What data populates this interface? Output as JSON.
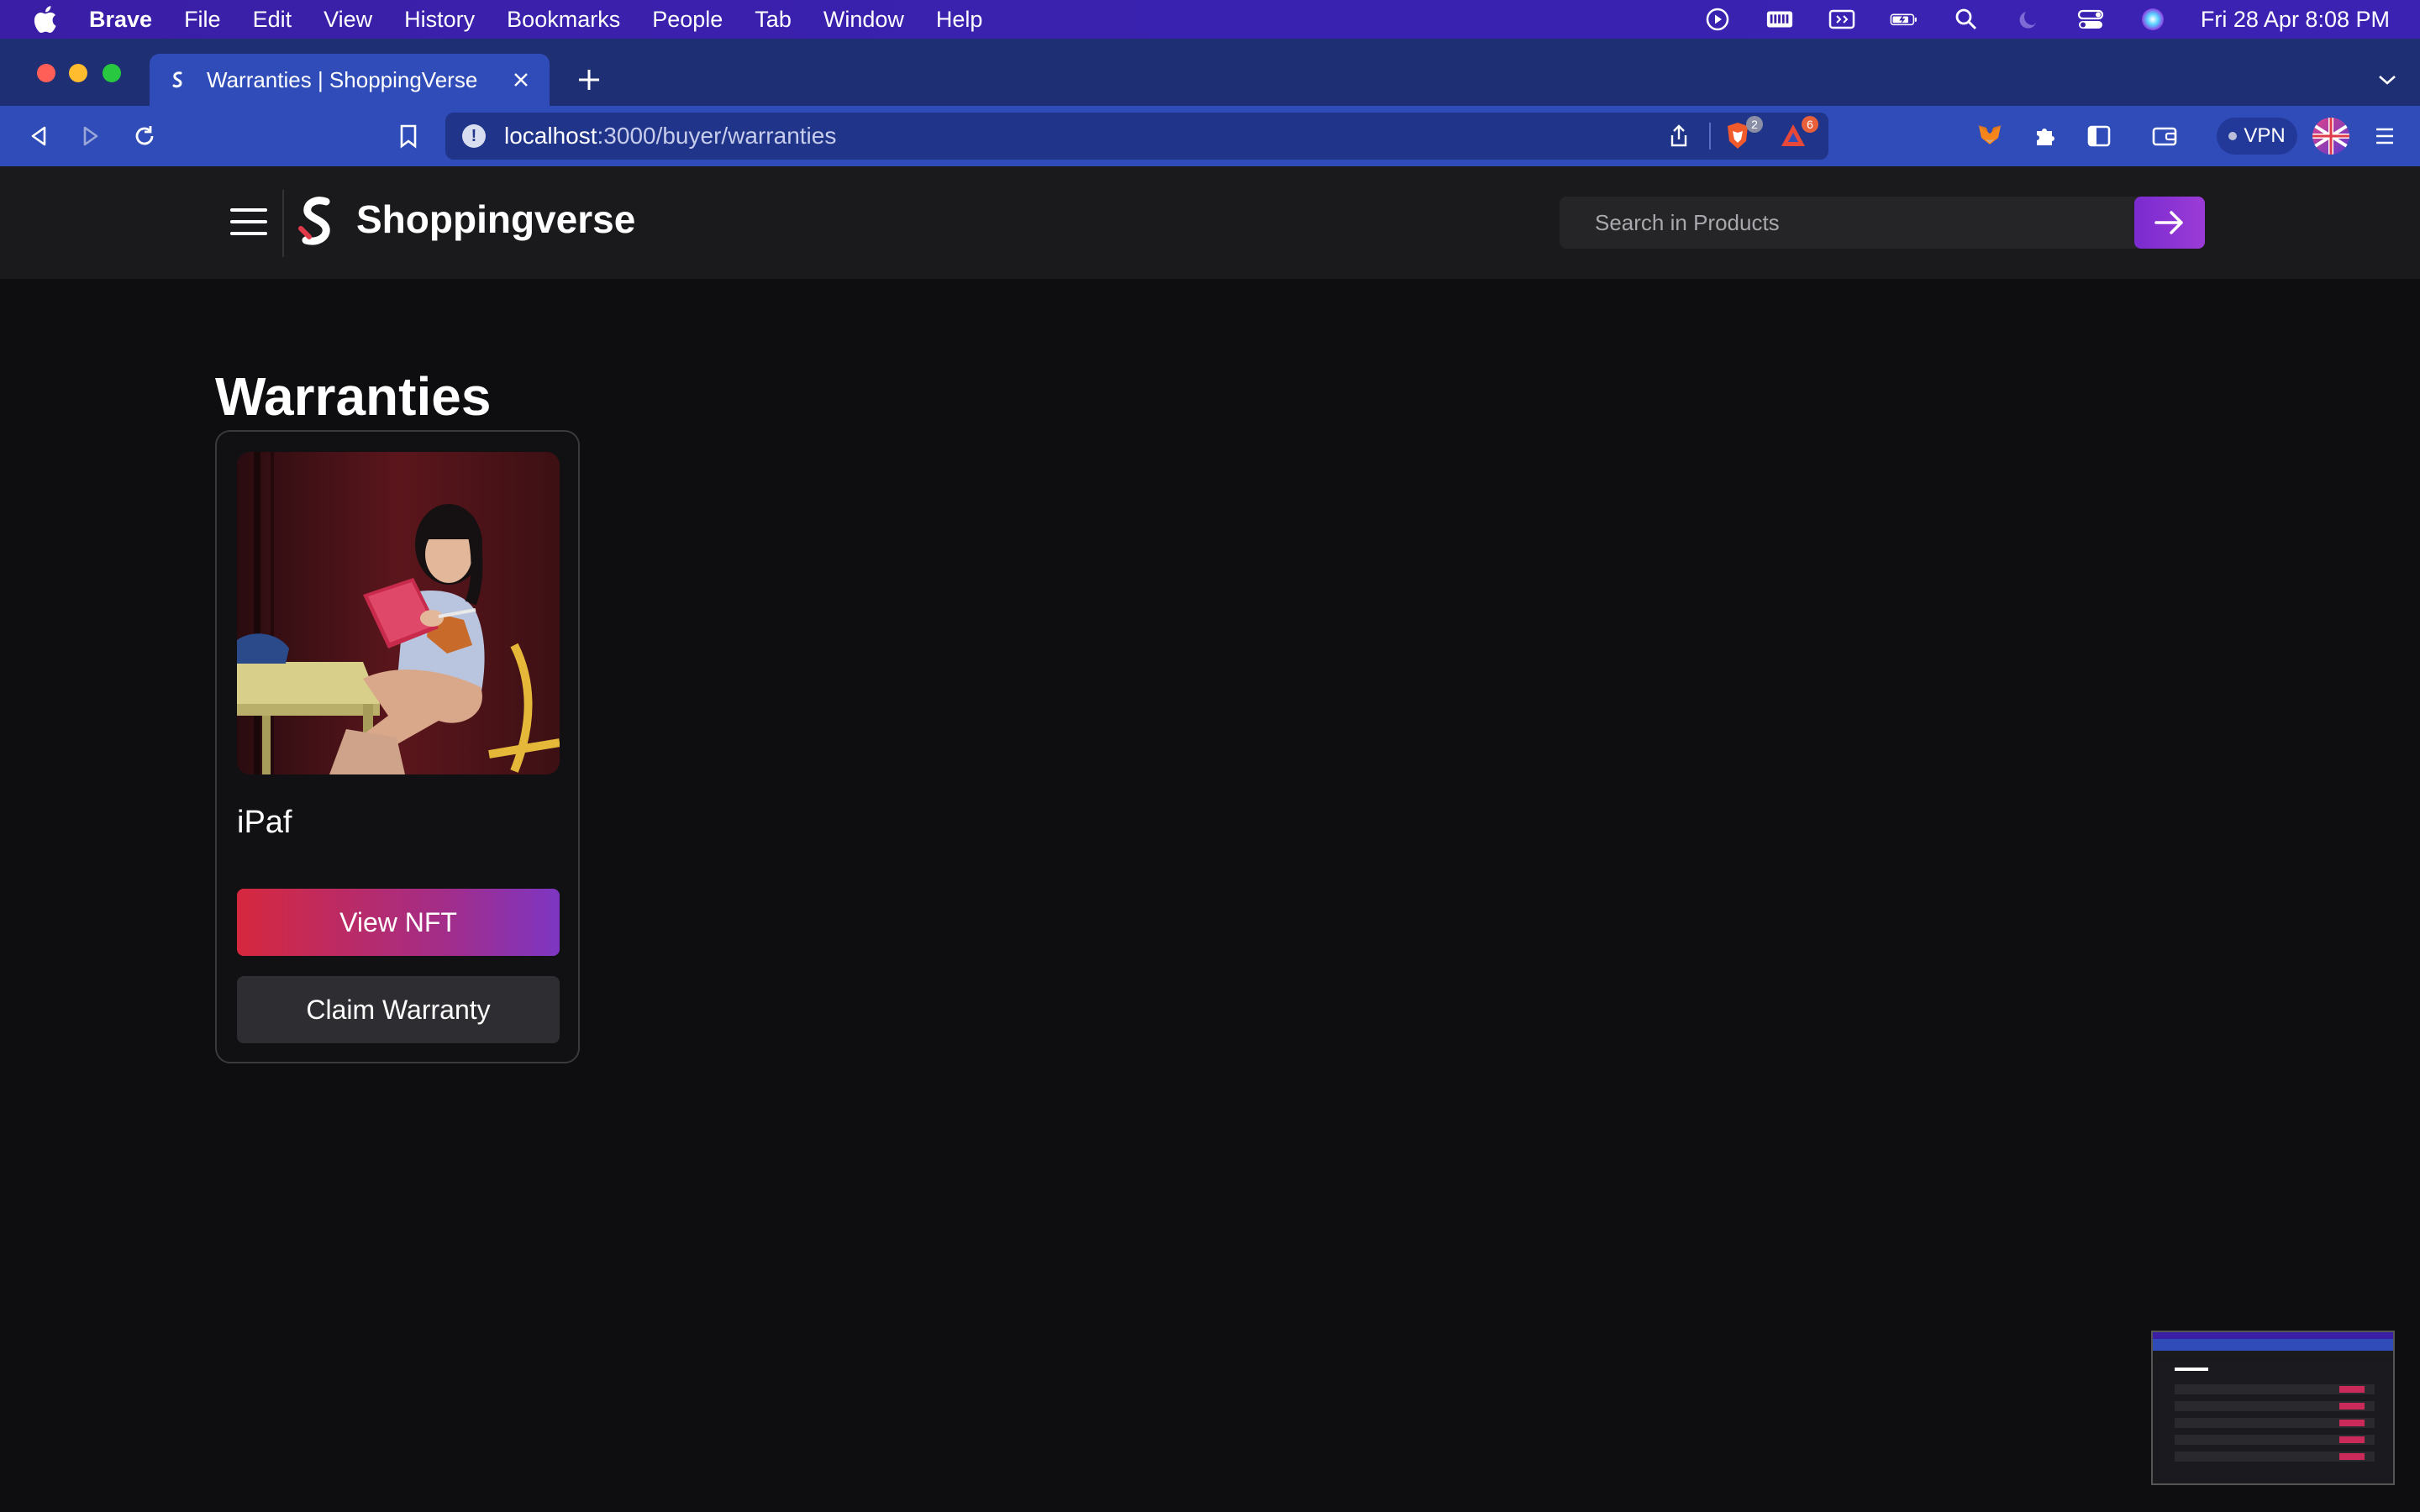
{
  "menubar": {
    "app": "Brave",
    "items": [
      "File",
      "Edit",
      "View",
      "History",
      "Bookmarks",
      "People",
      "Tab",
      "Window",
      "Help"
    ],
    "clock": "Fri 28 Apr  8:08 PM"
  },
  "browser": {
    "tab_title": "Warranties | ShoppingVerse",
    "url_host": "localhost",
    "url_path": ":3000/buyer/warranties",
    "shields_count": "2",
    "rewards_count": "6",
    "vpn_label": "VPN"
  },
  "site": {
    "brand": "Shoppingverse",
    "search_placeholder": "Search in Products"
  },
  "page": {
    "title": "Warranties",
    "cards": [
      {
        "product_name": "iPaf",
        "view_nft_label": "View NFT",
        "claim_label": "Claim Warranty"
      }
    ]
  },
  "colors": {
    "menubar": "#3a1ea6",
    "browser_chrome": "#2f4cb8",
    "background": "#0e0e10",
    "accent_start": "#d6283e",
    "accent_end": "#7d36c3"
  }
}
